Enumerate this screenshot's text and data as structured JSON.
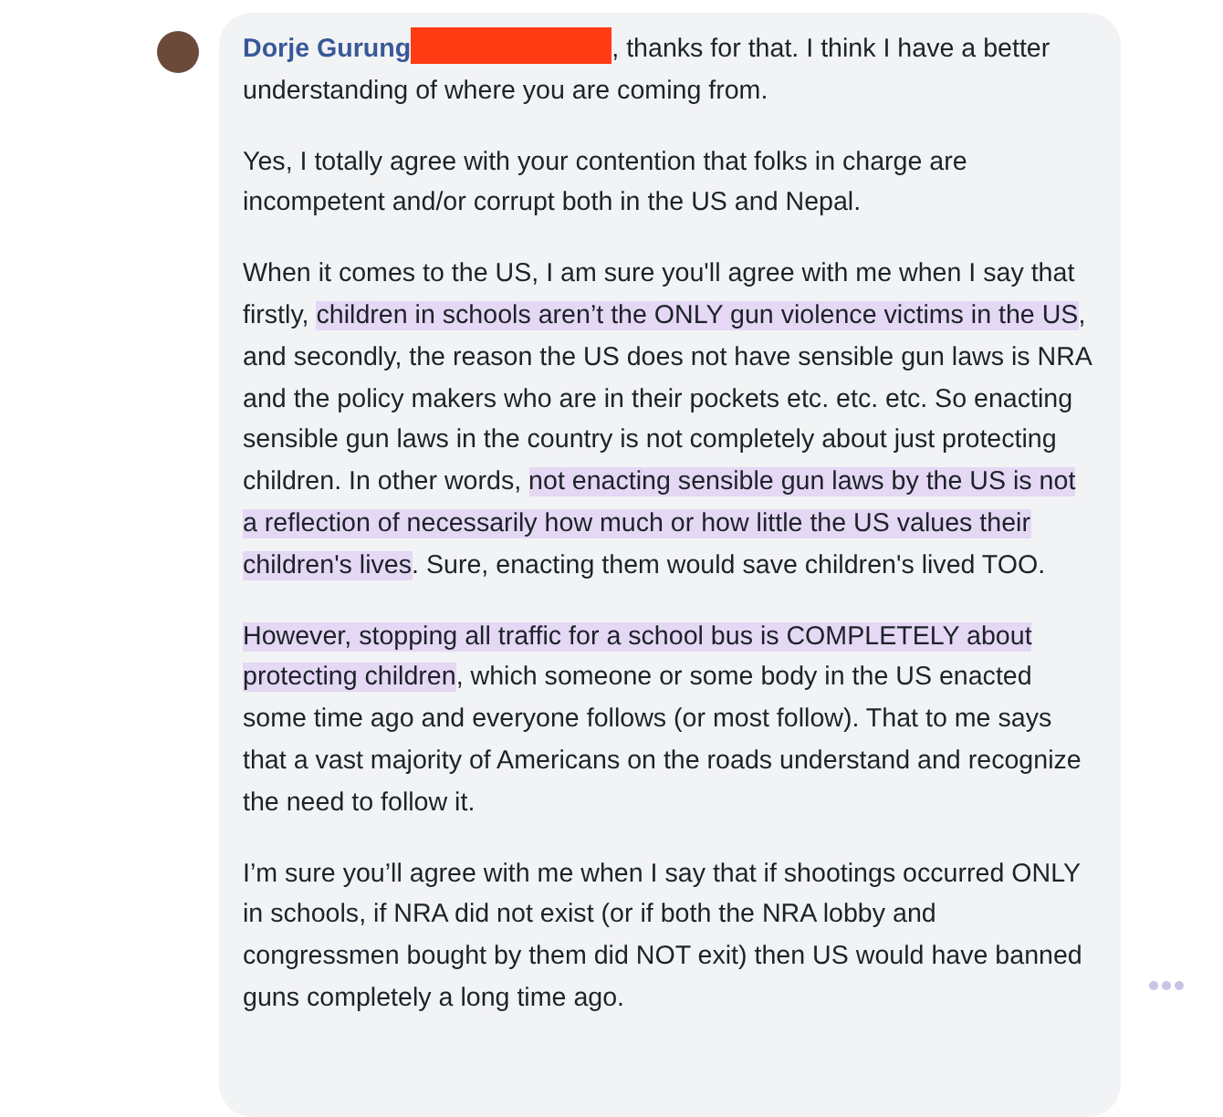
{
  "comment": {
    "author": "Dorje Gurung",
    "author_redacted": true,
    "paragraphs": [
      [
        {
          "text": ", thanks for that. I think I have a better understanding of where you are coming from.",
          "highlighted": false
        }
      ],
      [
        {
          "text": "Yes, I totally agree with your contention that folks in charge are incompetent and/or corrupt both in the US and Nepal.",
          "highlighted": false
        }
      ],
      [
        {
          "text": "When it comes to the US, I am sure you'll agree with me when I say that firstly, ",
          "highlighted": false
        },
        {
          "text": "children in schools aren’t the ONLY gun violence victims in the US",
          "highlighted": true
        },
        {
          "text": ", and secondly, the reason the US does not have sensible gun laws is NRA and the policy makers who are in their pockets etc. etc. etc. So enacting sensible gun laws in the country is not completely about just protecting children. In other words, ",
          "highlighted": false
        },
        {
          "text": "not enacting sensible gun laws by the US is not a reflection of necessarily how much or how little the US values their children's lives",
          "highlighted": true
        },
        {
          "text": ". Sure, enacting them would save children's lived TOO.",
          "highlighted": false
        }
      ],
      [
        {
          "text": "However, stopping all traffic for a school bus is COMPLETELY about protecting children",
          "highlighted": true
        },
        {
          "text": ", which someone or some body in the US enacted some time ago and everyone follows (or most follow). That to me says that a vast majority of Americans on the roads understand and recognize the need to follow it.",
          "highlighted": false
        }
      ],
      [
        {
          "text": "I’m sure you’ll agree with me when I say that if shootings occurred ONLY in schools, if NRA did not exist (or if both the NRA lobby and congressmen bought by them did NOT exit) then US would have banned guns completely a long time ago.",
          "highlighted": false
        }
      ]
    ]
  }
}
